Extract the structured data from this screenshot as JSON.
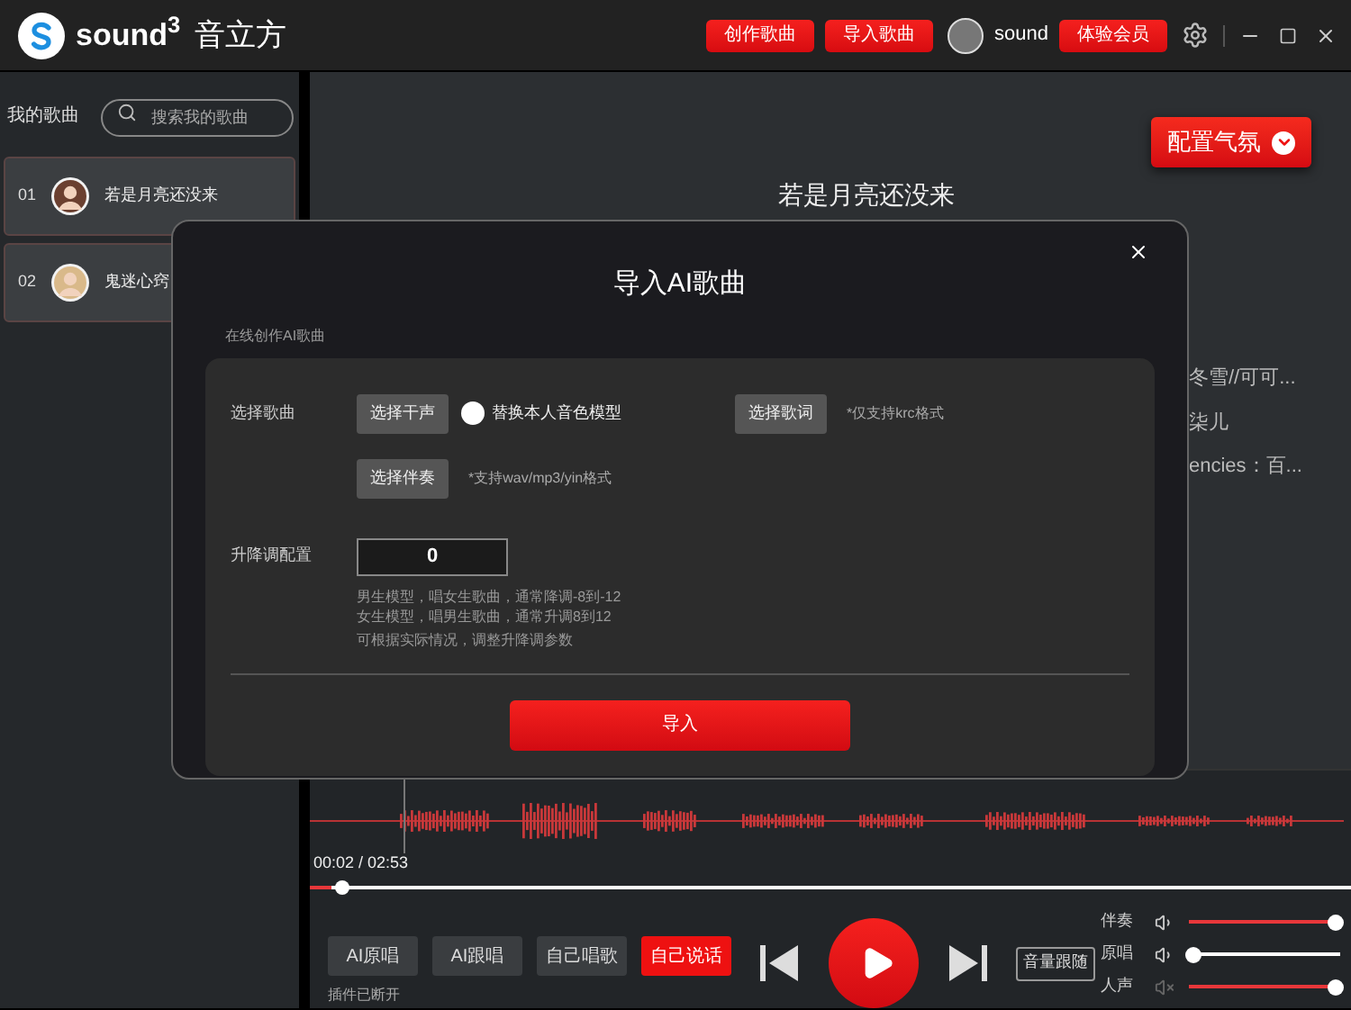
{
  "app": {
    "logo_text": "sound$^{3}$",
    "brand": "音立方"
  },
  "header": {
    "buttons": [
      "创作歌曲",
      "导入歌曲"
    ],
    "user": "sound",
    "vip": "体验会员"
  },
  "sidebar": {
    "heading": "我的歌曲",
    "search": {
      "placeholder": "搜索我的歌曲"
    },
    "songs": [
      {
        "number": "01",
        "title": "若是月亮还没来"
      },
      {
        "number": "02",
        "title": "鬼迷心窍"
      }
    ]
  },
  "main": {
    "atmosphere_button": "配置气氛",
    "song_title": "若是月亮还没来",
    "info_lines": [
      "冬雪//可可...",
      "柒儿",
      "encies：百..."
    ]
  },
  "dialog": {
    "title": "导入AI歌曲",
    "subtitle": "在线创作AI歌曲",
    "song_label": "选择歌曲",
    "vocal_button": "选择干声",
    "voice_model": {
      "label": "替换本人音色模型",
      "checked": false
    },
    "lyrics_button": "选择歌词",
    "lyrics_hint": "*仅支持krc格式",
    "accompaniment_button": "选择伴奏",
    "accompaniment_hint": "*支持wav/mp3/yin格式",
    "pitch_label": "升降调配置",
    "pitch_value": "0",
    "notes": [
      "男生模型，唱女生歌曲，通常降调-8到-12",
      "女生模型，唱男生歌曲，通常升调8到12",
      "可根据实际情况，调整升降调参数"
    ],
    "import_button": "导入"
  },
  "player": {
    "time": "00:02 / 02:53",
    "progress": {
      "level": 0.02
    },
    "modes": [
      {
        "label": "AI原唱",
        "selected": false
      },
      {
        "label": "AI跟唱",
        "selected": false
      },
      {
        "label": "自己唱歌",
        "selected": false
      },
      {
        "label": "自己说话",
        "selected": true
      }
    ],
    "status": "插件已断开",
    "volume_follow": "音量跟随",
    "mixers": [
      {
        "label": "伴奏",
        "muted": false,
        "level": 0.97
      },
      {
        "label": "原唱",
        "muted": false,
        "level": 0.02
      },
      {
        "label": "人声",
        "muted": true,
        "level": 0.97
      }
    ]
  }
}
